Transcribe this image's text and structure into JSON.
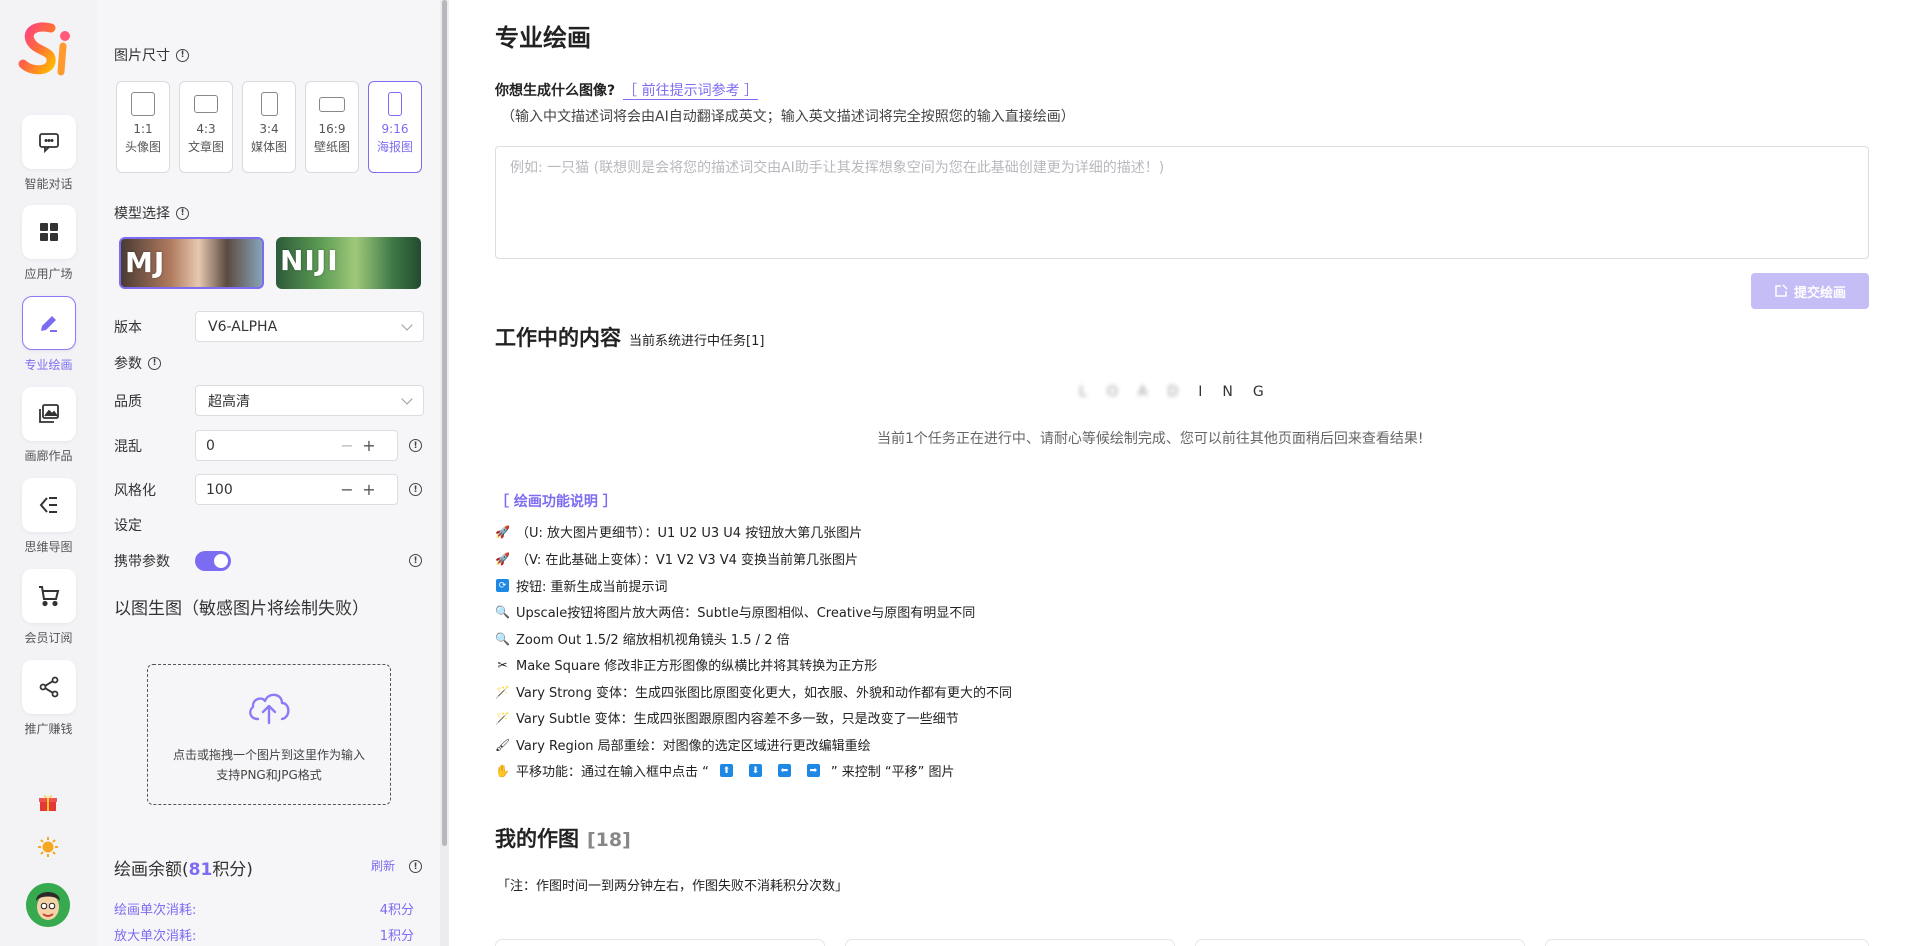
{
  "rail": {
    "items": [
      {
        "label": "智能对话"
      },
      {
        "label": "应用广场"
      },
      {
        "label": "专业绘画"
      },
      {
        "label": "画廊作品"
      },
      {
        "label": "思维导图"
      },
      {
        "label": "会员订阅"
      },
      {
        "label": "推广赚钱"
      }
    ],
    "active_index": 2,
    "accent": "#7c6cf2"
  },
  "panel": {
    "size_label": "图片尺寸",
    "sizes": [
      {
        "ratio": "1:1",
        "name": "头像图"
      },
      {
        "ratio": "4:3",
        "name": "文章图"
      },
      {
        "ratio": "3:4",
        "name": "媒体图"
      },
      {
        "ratio": "16:9",
        "name": "壁纸图"
      },
      {
        "ratio": "9:16",
        "name": "海报图"
      }
    ],
    "selected_size": "9:16",
    "model_label": "模型选择",
    "models": [
      {
        "name": "MJ"
      },
      {
        "name": "NIJI"
      }
    ],
    "selected_model": "MJ",
    "version_label": "版本",
    "version_value": "V6-ALPHA",
    "params_label": "参数",
    "quality_label": "品质",
    "quality_value": "超高清",
    "chaos_label": "混乱",
    "chaos_value": "0",
    "stylize_label": "风格化",
    "stylize_value": "100",
    "settings_label": "设定",
    "carry_label": "携带参数",
    "carry_enabled": true,
    "img2img_label": "以图生图（敏感图片将绘制失败）",
    "upload_line1": "点击或拖拽一个图片到这里作为输入",
    "upload_line2": "支持PNG和JPG格式",
    "credit_prefix": "绘画余额(",
    "credit_value": "81",
    "credit_suffix": "积分)",
    "refresh_label": "刷新",
    "draw_cost_label": "绘画单次消耗:",
    "draw_cost_value": "4积分",
    "upscale_cost_label": "放大单次消耗:",
    "upscale_cost_value": "1积分"
  },
  "main": {
    "title": "专业绘画",
    "question": "你想生成什么图像?",
    "prompt_link": "［ 前往提示词参考 ］",
    "hint": "（输入中文描述词将会由AI自动翻译成英文；输入英文描述词将完全按照您的输入直接绘画）",
    "prompt_placeholder": "例如: 一只猫 (联想则是会将您的描述词交由AI助手让其发挥想象空间为您在此基础创建更为详细的描述！)",
    "submit_label": "提交绘画",
    "working_title": "工作中的内容",
    "working_sub": "当前系统进行中任务[1]",
    "loading_letters": [
      "L",
      "O",
      "A",
      "D",
      "I",
      "N",
      "G"
    ],
    "loading_message": "当前1个任务正在进行中、请耐心等候绘制完成、您可以前往其他页面稍后回来查看结果!",
    "func_title": "［ 绘画功能说明 ］",
    "func_items": [
      {
        "icon": "rocket-icon",
        "text": "（U: 放大图片更细节）：U1 U2 U3 U4 按钮放大第几张图片"
      },
      {
        "icon": "rocket-icon",
        "text": "（V: 在此基础上变体）：V1 V2 V3 V4 变换当前第几张图片"
      },
      {
        "icon": "refresh-icon",
        "text": "按钮:   重新生成当前提示词"
      },
      {
        "icon": "magnifier-icon",
        "text": "Upscale按钮将图片放大两倍：Subtle与原图相似、Creative与原图有明显不同"
      },
      {
        "icon": "magnifier-icon",
        "text": "Zoom Out 1.5/2 缩放相机视角镜头 1.5 / 2 倍"
      },
      {
        "icon": "scissors-icon",
        "text": "Make Square 修改非正方形图像的纵横比并将其转换为正方形"
      },
      {
        "icon": "wand-icon",
        "text": "Vary Strong 变体：生成四张图比原图变化更大，如衣服、外貌和动作都有更大的不同"
      },
      {
        "icon": "wand-icon",
        "text": "Vary Subtle 变体：生成四张图跟原图内容差不多一致，只是改变了一些细节"
      },
      {
        "icon": "brush-icon",
        "text": "Vary Region 局部重绘：对图像的选定区域进行更改编辑重绘"
      },
      {
        "icon": "hand-icon",
        "text": "平移功能：通过在输入框中点击 “",
        "tail": " ” 来控制 “平移” 图片"
      }
    ],
    "arrow_keys": [
      "⬆",
      "⬇",
      "⬅",
      "➡"
    ],
    "mine_title": "我的作图",
    "mine_count": "[18]",
    "note": "「注：作图时间一到两分钟左右，作图失败不消耗积分次数」"
  }
}
